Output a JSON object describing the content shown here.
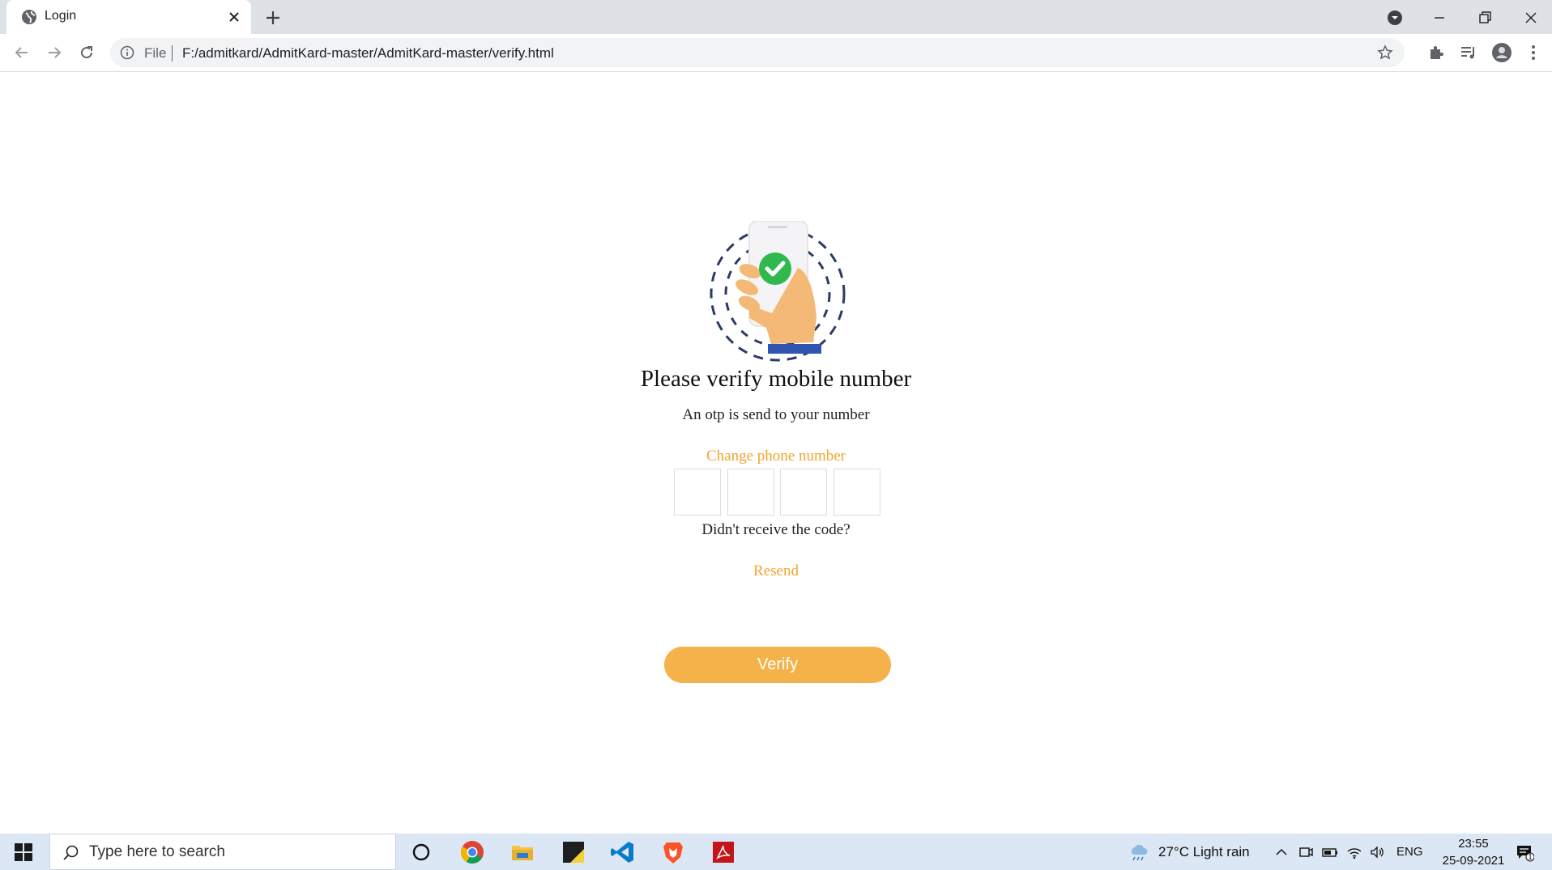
{
  "browser": {
    "tab_title": "Login",
    "address_scheme": "File",
    "address_url": "F:/admitkard/AdmitKard-master/AdmitKard-master/verify.html"
  },
  "page": {
    "title": "Please verify mobile number",
    "subtitle": "An otp is send to your number",
    "change_phone_link": "Change phone number",
    "otp_digits": [
      "",
      "",
      "",
      ""
    ],
    "no_code_text": "Didn't receive the code?",
    "resend_link": "Resend",
    "verify_button": "Verify",
    "accent_color": "#f5b24a"
  },
  "taskbar": {
    "search_placeholder": "Type here to search",
    "weather": "27°C  Light rain",
    "language": "ENG",
    "time": "23:55",
    "date": "25-09-2021",
    "notification_count": "1"
  }
}
